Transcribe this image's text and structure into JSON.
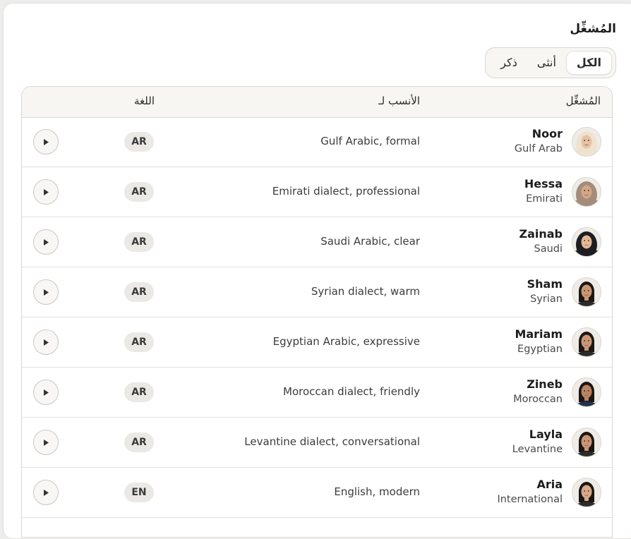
{
  "heading": "المُشغِّل",
  "filter": {
    "options": [
      "الكل",
      "أنثى",
      "ذكر"
    ],
    "selected": 0
  },
  "table": {
    "headers": {
      "operator": "المُشغِّل",
      "best_for": "الأنسب لـ",
      "language": "اللغة"
    },
    "rows": [
      {
        "name": "Noor",
        "origin": "Gulf Arab",
        "description": "Gulf Arabic, formal",
        "lang": "AR",
        "avatar": "avatar-hijab-cream"
      },
      {
        "name": "Hessa",
        "origin": "Emirati",
        "description": "Emirati dialect, professional",
        "lang": "AR",
        "avatar": "avatar-hijab-taupe"
      },
      {
        "name": "Zainab",
        "origin": "Saudi",
        "description": "Saudi Arabic, clear",
        "lang": "AR",
        "avatar": "avatar-hijab-black"
      },
      {
        "name": "Sham",
        "origin": "Syrian",
        "description": "Syrian dialect, warm",
        "lang": "AR",
        "avatar": "avatar-dark-hair"
      },
      {
        "name": "Mariam",
        "origin": "Egyptian",
        "description": "Egyptian Arabic, expressive",
        "lang": "AR",
        "avatar": "avatar-dark-hair"
      },
      {
        "name": "Zineb",
        "origin": "Moroccan",
        "description": "Moroccan dialect, friendly",
        "lang": "AR",
        "avatar": "avatar-dark-hair-navy"
      },
      {
        "name": "Layla",
        "origin": "Levantine",
        "description": "Levantine dialect, conversational",
        "lang": "AR",
        "avatar": "avatar-dark-hair"
      },
      {
        "name": "Aria",
        "origin": "International",
        "description": "English, modern",
        "lang": "EN",
        "avatar": "avatar-dark-hair-light"
      }
    ]
  },
  "colors": {
    "panel_bg": "#ffffff",
    "page_bg": "#ededeb",
    "header_bg": "#f7f6f3",
    "border": "#d9d7d2",
    "badge_bg": "#ebe9e5"
  }
}
